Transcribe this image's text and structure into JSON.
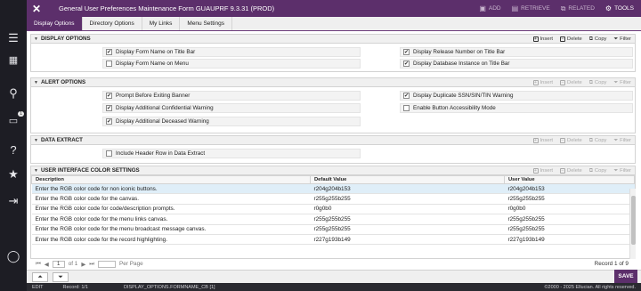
{
  "window": {
    "title": "General User Preferences Maintenance Form GUAUPRF 9.3.31 (PROD)"
  },
  "topbar": {
    "actions": [
      {
        "label": "ADD",
        "icon": "add-icon",
        "enabled": false
      },
      {
        "label": "RETRIEVE",
        "icon": "retrieve-icon",
        "enabled": false
      },
      {
        "label": "RELATED",
        "icon": "related-icon",
        "enabled": false
      },
      {
        "label": "TOOLS",
        "icon": "gear-icon",
        "enabled": true
      }
    ]
  },
  "tabs": [
    "Display Options",
    "Directory Options",
    "My Links",
    "Menu Settings"
  ],
  "toolbar": {
    "insert": "Insert",
    "delete": "Delete",
    "copy": "Copy",
    "filter": "Filter"
  },
  "sections": {
    "display_options": {
      "title": "DISPLAY OPTIONS",
      "items": [
        {
          "label": "Display Form Name on Title Bar",
          "checked": true
        },
        {
          "label": "Display Form Name on Menu",
          "checked": false
        },
        {
          "label": "Display Release Number on Title Bar",
          "checked": true
        },
        {
          "label": "Display Database Instance on Title Bar",
          "checked": true
        }
      ]
    },
    "alert_options": {
      "title": "ALERT OPTIONS",
      "items": [
        {
          "label": "Prompt Before Exiting Banner",
          "checked": true
        },
        {
          "label": "Display Additional Confidential Warning",
          "checked": true
        },
        {
          "label": "Display Additional Deceased Warning",
          "checked": true
        },
        {
          "label": "Display Duplicate SSN/SIN/TIN Warning",
          "checked": true
        },
        {
          "label": "Enable Button Accessibility Mode",
          "checked": false
        }
      ]
    },
    "data_extract": {
      "title": "DATA EXTRACT",
      "items": [
        {
          "label": "Include Header Row in Data Extract",
          "checked": false
        }
      ]
    },
    "color_settings": {
      "title": "USER INTERFACE COLOR SETTINGS",
      "columns": [
        "Description",
        "Default Value",
        "User Value"
      ],
      "rows": [
        [
          "Enter the RGB color code for non iconic buttons.",
          "r204g204b153",
          "r204g204b153"
        ],
        [
          "Enter the RGB color code for the canvas.",
          "r255g255b255",
          "r255g255b255"
        ],
        [
          "Enter the RGB color code for code/description prompts.",
          "r0g0b0",
          "r0g0b0"
        ],
        [
          "Enter the RGB color code for the menu links canvas.",
          "r255g255b255",
          "r255g255b255"
        ],
        [
          "Enter the RGB color code for the menu broadcast message canvas.",
          "r255g255b255",
          "r255g255b255"
        ],
        [
          "Enter the RGB color code for the record highlighting.",
          "r227g193b149",
          "r227g193b149"
        ]
      ]
    }
  },
  "pager": {
    "page": "1",
    "of_label": "of 1",
    "per_page": "Per Page",
    "record": "Record 1 of 9"
  },
  "bottom": {
    "save": "SAVE"
  },
  "statusbar": {
    "left": "EDIT",
    "mid": "Record: 1/1",
    "form": "DISPLAY_OPTIONS.FORMNAME_CB [1]",
    "right": "©2000 - 2025 Ellucian. All rights reserved."
  }
}
